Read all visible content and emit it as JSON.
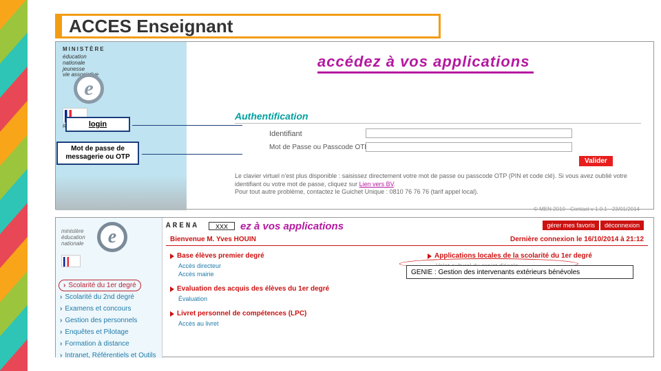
{
  "title": "ACCES Enseignant",
  "panel1": {
    "ministry_small": "MINISTÈRE",
    "ministry_lines": "éducation\nnationale\njeunesse\nvie associative",
    "rf": "RÉPUBLIQUE FRANÇAISE",
    "app_line": "accédez à vos applications",
    "auth_header": "Authentification",
    "id_label": "Identifiant",
    "mdp_label": "Mot de Passe ou Passcode OTP",
    "valider": "Valider",
    "help": "Le clavier virtuel n'est plus disponible : saisissez directement votre mot de passe ou passcode OTP (PIN et code clé).\nSi vous avez oublié votre identifiant ou votre mot de passe, cliquez sur ",
    "help_link": "Lien vers BV",
    "help2": "Pour tout autre problème, contactez le Guichet Unique : 0810 76 76 76 (tarif appel local).",
    "label_login": "login",
    "label_mdp": "Mot de passe de messagerie ou OTP"
  },
  "panel2": {
    "ministry_lines": "ministère\néducation\nnationale",
    "arena": "ARENA",
    "xxx": "XXX",
    "app_line": "ez à vos applications",
    "tab_fav": "gérer mes favoris",
    "tab_dec": "déconnexion",
    "welcome": "Bienvenue M. Yves HOUIN",
    "lastcon": "Dernière connexion le 16/10/2014 à 21:12",
    "menu": [
      "Scolarité du 1er degré",
      "Scolarité du 2nd degré",
      "Examens et concours",
      "Gestion des personnels",
      "Enquêtes et Pilotage",
      "Formation à distance",
      "Intranet, Référentiels et Outils"
    ],
    "sec1": "Base élèves premier degré",
    "sec1_subs": [
      "Accès directeur",
      "Accès mairie"
    ],
    "sec2": "Evaluation des acquis des élèves du 1er degré",
    "sec2_subs": [
      "Évaluation"
    ],
    "sec3": "Livret personnel de compétences (LPC)",
    "sec3_subs": [
      "Accès au livret"
    ],
    "sec4": "Applications locales de la scolarité du 1er degré",
    "sec4_subs": [
      "Volet culturel du projet d'école"
    ],
    "highlight": "GENIE : Gestion des intervenants extérieurs bénévoles",
    "footer": "© MEN 2010 - Contact v 1.0.1 - 23/01/2014"
  }
}
